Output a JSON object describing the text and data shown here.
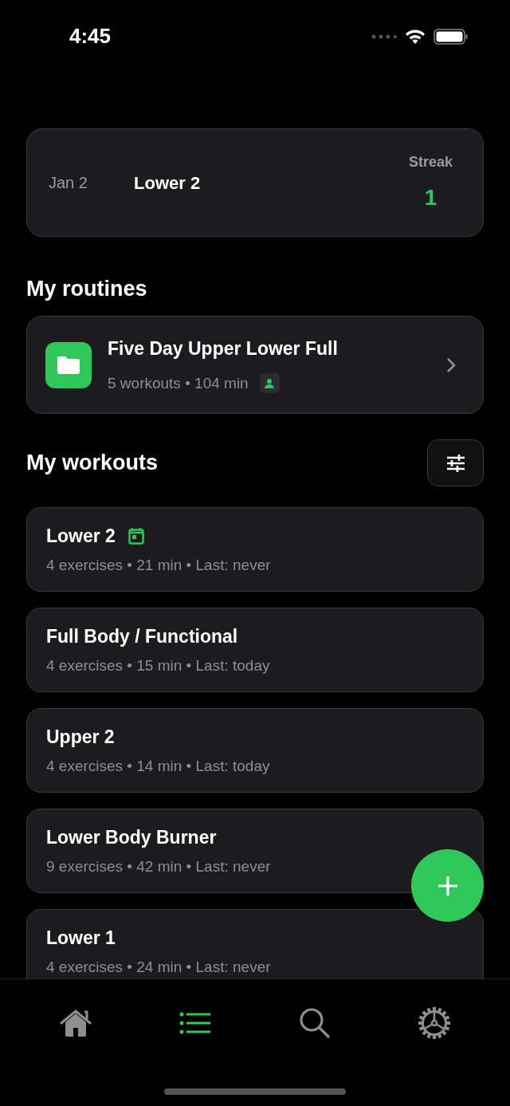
{
  "status_bar": {
    "time": "4:45"
  },
  "streak_card": {
    "date": "Jan 2",
    "workout": "Lower 2",
    "streak_label": "Streak",
    "streak_value": "1"
  },
  "routines": {
    "title": "My routines",
    "items": [
      {
        "name": "Five Day Upper Lower Full",
        "meta": "5 workouts • 104 min",
        "personal": true
      }
    ]
  },
  "workouts": {
    "title": "My workouts",
    "items": [
      {
        "name": "Lower 2",
        "meta": "4 exercises • 21 min • Last: never",
        "scheduled": true
      },
      {
        "name": "Full Body / Functional",
        "meta": "4 exercises • 15 min • Last: today",
        "scheduled": false
      },
      {
        "name": "Upper 2",
        "meta": "4 exercises • 14 min • Last: today",
        "scheduled": false
      },
      {
        "name": "Lower Body Burner",
        "meta": "9 exercises • 42 min • Last: never",
        "scheduled": false
      },
      {
        "name": "Lower 1",
        "meta": "4 exercises • 24 min • Last: never",
        "scheduled": false
      }
    ]
  },
  "tab_bar": [
    {
      "kind": "home",
      "selected": false
    },
    {
      "kind": "list",
      "selected": true
    },
    {
      "kind": "search",
      "selected": false
    },
    {
      "kind": "settings",
      "selected": false
    }
  ]
}
